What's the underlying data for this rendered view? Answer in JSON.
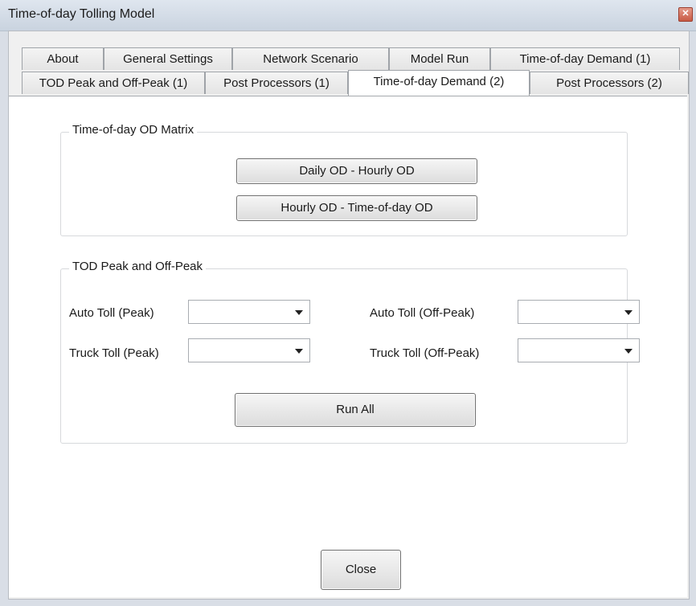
{
  "window": {
    "title": "Time-of-day Tolling Model",
    "close_glyph": "✕"
  },
  "tabs_row1": [
    {
      "label": "About"
    },
    {
      "label": "General Settings"
    },
    {
      "label": "Network Scenario"
    },
    {
      "label": "Model Run"
    },
    {
      "label": "Time-of-day Demand (1)"
    }
  ],
  "tabs_row2": [
    {
      "label": "TOD Peak and Off-Peak (1)"
    },
    {
      "label": "Post Processors (1)"
    },
    {
      "label": "Time-of-day Demand (2)",
      "active": true
    },
    {
      "label": "Post Processors (2)"
    }
  ],
  "od_group": {
    "title": "Time-of-day OD Matrix",
    "daily_button": "Daily OD - Hourly OD",
    "hourly_button": "Hourly OD - Time-of-day OD"
  },
  "peak_group": {
    "title": "TOD Peak and Off-Peak",
    "auto_peak_label": "Auto Toll (Peak)",
    "auto_peak_value": "",
    "auto_offpeak_label": "Auto Toll (Off-Peak)",
    "auto_offpeak_value": "",
    "truck_peak_label": "Truck Toll (Peak)",
    "truck_peak_value": "",
    "truck_offpeak_label": "Truck Toll (Off-Peak)",
    "truck_offpeak_value": "",
    "run_all_button": "Run All"
  },
  "footer": {
    "close_button": "Close"
  }
}
